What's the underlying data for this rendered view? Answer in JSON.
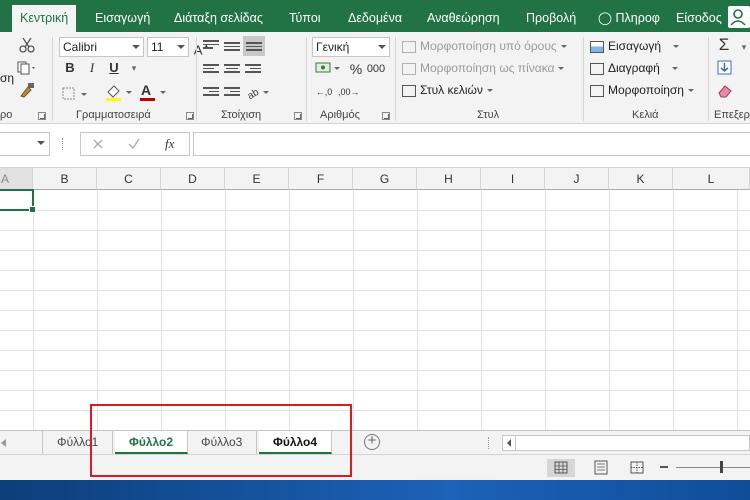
{
  "ribbon_tabs": [
    "Κεντρική",
    "Εισαγωγή",
    "Διάταξη σελίδας",
    "Τύποι",
    "Δεδομένα",
    "Αναθεώρηση",
    "Προβολή"
  ],
  "tell_me": "Πληροφ",
  "sign_in": "Είσοδος",
  "font": {
    "name": "Calibri",
    "size": "11"
  },
  "number_format": "Γενική",
  "styles": {
    "conditional": "Μορφοποίηση υπό όρους",
    "as_table": "Μορφοποίηση ως πίνακα",
    "cell_styles": "Στυλ κελιών"
  },
  "cells": {
    "insert": "Εισαγωγή",
    "delete": "Διαγραφή",
    "format": "Μορφοποίηση"
  },
  "group_labels": {
    "clipboard": "ρο",
    "font": "Γραμματοσειρά",
    "alignment": "Στοίχιση",
    "number": "Αριθμός",
    "styles": "Στυλ",
    "cells": "Κελιά",
    "editing": "Επεξεργ"
  },
  "formula": {
    "fx": "fx"
  },
  "columns": [
    "A",
    "B",
    "C",
    "D",
    "E",
    "F",
    "G",
    "H",
    "I",
    "J",
    "K",
    "L"
  ],
  "sheets": [
    {
      "name": "Φύλλο1",
      "selected": false
    },
    {
      "name": "Φύλλο2",
      "selected": true
    },
    {
      "name": "Φύλλο3",
      "selected": false
    },
    {
      "name": "Φύλλο4",
      "selected": true
    }
  ],
  "colors": {
    "accent": "#217346",
    "highlight_box": "#e0191f",
    "font_color": "#c00000",
    "fill_color": "#ffff00"
  }
}
